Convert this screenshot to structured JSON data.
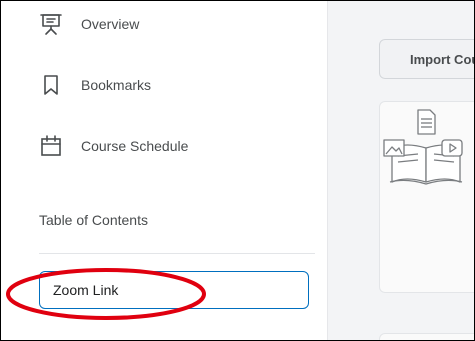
{
  "sidebar": {
    "items": [
      {
        "label": "Overview",
        "icon": "presentation-icon"
      },
      {
        "label": "Bookmarks",
        "icon": "bookmark-icon"
      },
      {
        "label": "Course Schedule",
        "icon": "calendar-icon"
      }
    ],
    "toc_heading": "Table of Contents",
    "toc_items": [
      {
        "label": "Zoom Link"
      }
    ]
  },
  "main": {
    "import_button_label": "Import Cou"
  },
  "colors": {
    "accent": "#006fbf",
    "highlight": "#e0000f",
    "text": "#494c4e",
    "panel": "#f3f4f6"
  }
}
